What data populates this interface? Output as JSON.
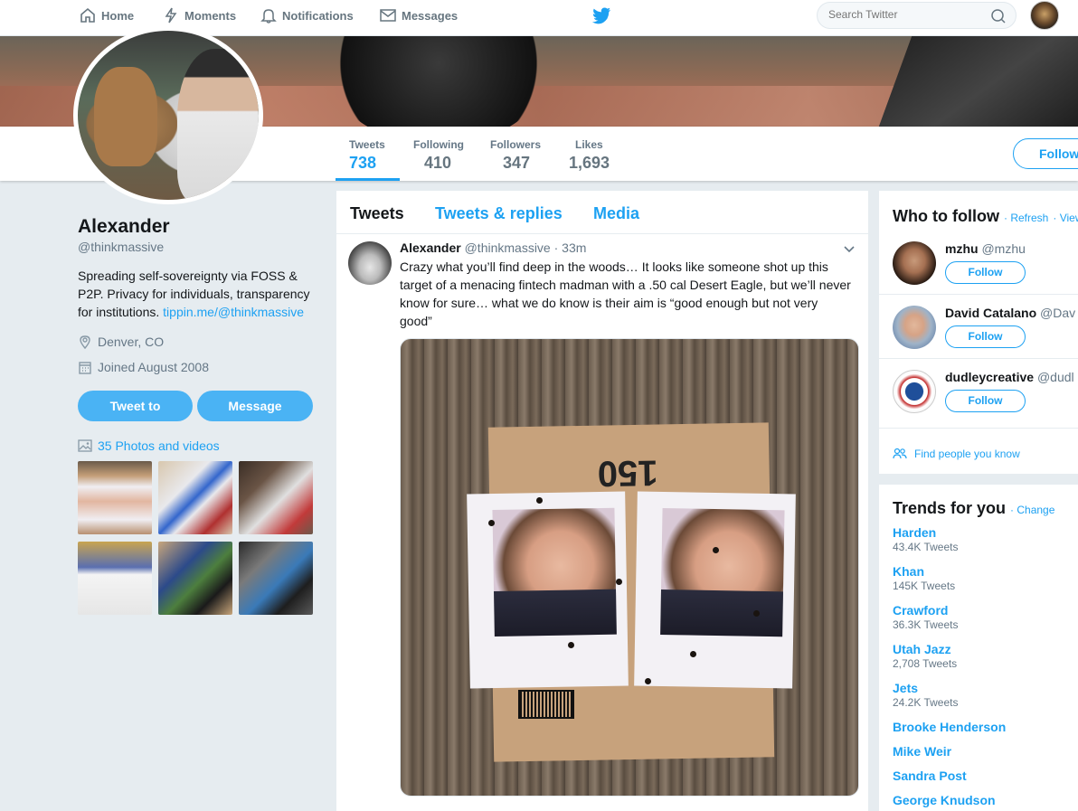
{
  "nav": {
    "home": "Home",
    "moments": "Moments",
    "notifications": "Notifications",
    "messages": "Messages",
    "search_placeholder": "Search Twitter"
  },
  "stats": {
    "tweets": {
      "label": "Tweets",
      "value": "738"
    },
    "following": {
      "label": "Following",
      "value": "410"
    },
    "followers": {
      "label": "Followers",
      "value": "347"
    },
    "likes": {
      "label": "Likes",
      "value": "1,693"
    },
    "follow_label": "Follow"
  },
  "profile": {
    "name": "Alexander",
    "handle": "@thinkmassive",
    "bio": "Spreading self-sovereignty via FOSS & P2P. Privacy for individuals, transparency for institutions. ",
    "bio_link": "tippin.me/@thinkmassive",
    "location": "Denver, CO",
    "joined": "Joined August 2008",
    "tweet_to": "Tweet to",
    "message": "Message",
    "photos": "35 Photos and videos"
  },
  "timeline": {
    "tabs": [
      "Tweets",
      "Tweets & replies",
      "Media"
    ],
    "tweet": {
      "name": "Alexander",
      "handle": "@thinkmassive",
      "time": "· 33m",
      "text": "Crazy what you’ll find deep in the woods… It looks like someone shot up this target of a menacing fintech madman with a .50 cal Desert Eagle, but we’ll never know for sure… what we do know is their aim is “good enough but not very good”",
      "box_number": "150"
    }
  },
  "who_to_follow": {
    "title": "Who to follow",
    "refresh": "· Refresh",
    "view_all": "· View all",
    "users": [
      {
        "name": "mzhu",
        "handle": "@mzhu",
        "button": "Follow"
      },
      {
        "name": "David Catalano",
        "handle": "@Dav",
        "button": "Follow"
      },
      {
        "name": "dudleycreative",
        "handle": "@dudl",
        "button": "Follow"
      }
    ],
    "find_people": "Find people you know"
  },
  "trends": {
    "title": "Trends for you",
    "change": "· Change",
    "items": [
      {
        "name": "Harden",
        "count": "43.4K Tweets"
      },
      {
        "name": "Khan",
        "count": "145K Tweets"
      },
      {
        "name": "Crawford",
        "count": "36.3K Tweets"
      },
      {
        "name": "Utah Jazz",
        "count": "2,708 Tweets"
      },
      {
        "name": "Jets",
        "count": "24.2K Tweets"
      },
      {
        "name": "Brooke Henderson"
      },
      {
        "name": "Mike Weir"
      },
      {
        "name": "Sandra Post"
      },
      {
        "name": "George Knudson"
      }
    ]
  },
  "colors": {
    "accent": "#1da1f2",
    "button_fill": "#4ab3f4",
    "background": "#e6ecf0"
  }
}
